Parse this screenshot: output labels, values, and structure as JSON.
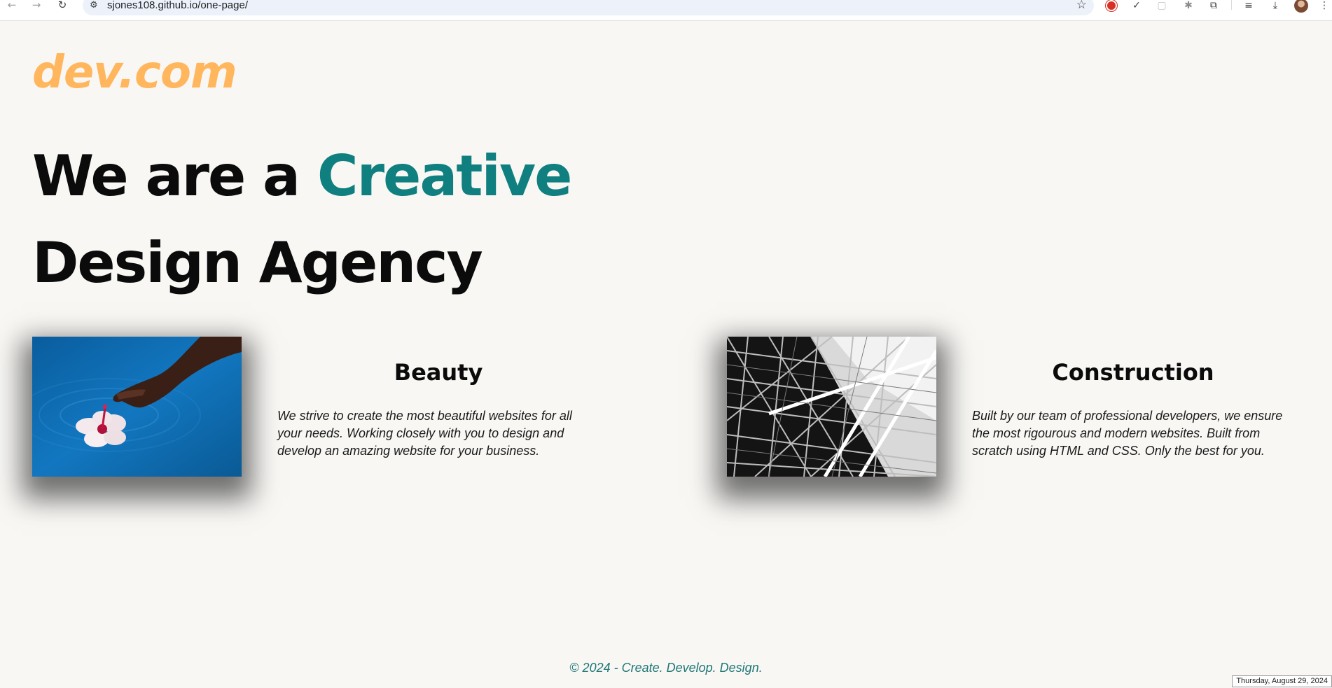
{
  "browser": {
    "url": "sjones108.github.io/one-page/",
    "icons": {
      "back": "arrow-left",
      "forward": "arrow-right",
      "reload": "reload",
      "site_settings": "tune",
      "bookmark": "star",
      "extensions": [
        "record",
        "check-circle",
        "square",
        "bug",
        "puzzle",
        "playlist",
        "download",
        "profile-avatar",
        "more-vertical"
      ]
    },
    "glyphs": {
      "back": "←",
      "forward": "→",
      "reload": "↻",
      "tune": "⚙",
      "star": "☆",
      "check": "✓",
      "square": "▢",
      "bug": "✱",
      "puzzle": "⧉",
      "playlist": "≡",
      "download": "⤓",
      "more": "⋮"
    }
  },
  "site": {
    "logo": "dev.com",
    "hero": {
      "line1_prefix": "We are a ",
      "line1_accent": "Creative",
      "line2": "Design Agency"
    },
    "cards": [
      {
        "image": "hand-touching-water-with-hibiscus-flower",
        "heading": "Beauty",
        "text": "We strive to create the most beautiful websites for all your needs. Working closely with you to design and develop an amazing website for your business."
      },
      {
        "image": "steel-lattice-structure-black-and-white",
        "heading": "Construction",
        "text": "Built by our team of professional developers, we ensure the most rigourous and modern websites. Built from scratch using HTML and CSS. Only the best for you."
      }
    ],
    "footer": "© 2024 - Create. Develop. Design."
  },
  "taskbar": {
    "date": "Thursday, August 29, 2024"
  },
  "colors": {
    "background": "#f8f7f4",
    "logo": "#ffb65c",
    "accent": "#0f7f7f",
    "footer": "#1e7777",
    "heading": "#0b0b0b"
  }
}
